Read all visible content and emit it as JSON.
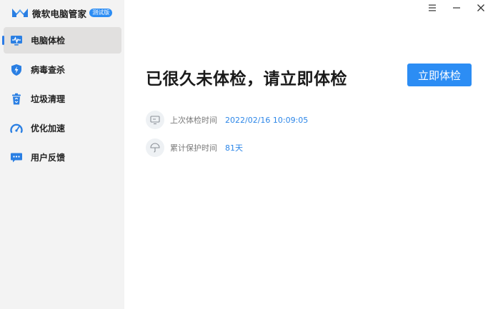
{
  "app": {
    "title": "微软电脑管家",
    "badge": "测试版"
  },
  "sidebar": {
    "items": [
      {
        "label": "电脑体检",
        "icon": "monitor-pulse-icon",
        "active": true
      },
      {
        "label": "病毒查杀",
        "icon": "shield-icon",
        "active": false
      },
      {
        "label": "垃圾清理",
        "icon": "trash-can-icon",
        "active": false
      },
      {
        "label": "优化加速",
        "icon": "speedometer-icon",
        "active": false
      },
      {
        "label": "用户反馈",
        "icon": "chat-bubble-icon",
        "active": false
      }
    ]
  },
  "window_controls": {
    "menu": "menu-icon",
    "minimize": "minimize-icon",
    "close": "close-icon"
  },
  "main": {
    "headline": "已很久未体检，请立即体检",
    "cta_label": "立即体检",
    "last_check": {
      "label": "上次体检时间",
      "value": "2022/02/16 10:09:05"
    },
    "protection": {
      "label": "累计保护时间",
      "value": "81天"
    }
  },
  "colors": {
    "accent": "#2c8df4",
    "sidebar_bg": "#f3f3f3",
    "active_item_bg": "#e1e0df",
    "link_value": "#2c86e8"
  }
}
